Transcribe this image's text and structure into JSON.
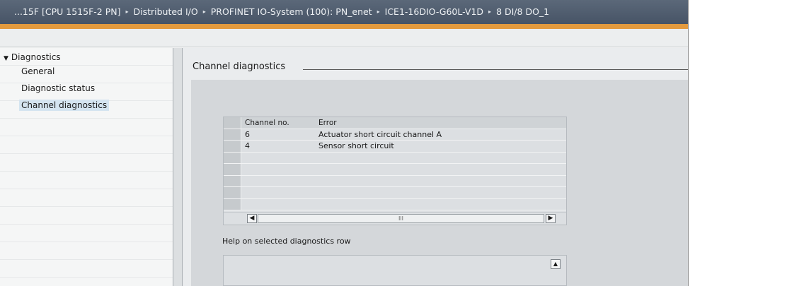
{
  "breadcrumb": [
    "...15F [CPU 1515F-2 PN]",
    "Distributed I/O",
    "PROFINET IO-System (100): PN_enet",
    "ICE1-16DIO-G60L-V1D",
    "8 DI/8 DO_1"
  ],
  "breadcrumb_separator": "▸",
  "nav": {
    "group_label": "Diagnostics",
    "items": [
      "General",
      "Diagnostic status",
      "Channel diagnostics"
    ],
    "selected": "Channel diagnostics"
  },
  "section": {
    "title": "Channel diagnostics"
  },
  "table": {
    "columns": [
      "Channel no.",
      "Error"
    ],
    "rows": [
      {
        "channel": "6",
        "error": "Actuator short circuit channel A"
      },
      {
        "channel": "4",
        "error": "Sensor short circuit"
      }
    ],
    "empty_rows": 5
  },
  "scrollbar": {
    "thumb_grip": "III"
  },
  "help": {
    "label": "Help on selected diagnostics row"
  },
  "colors": {
    "title_bar": "#4f5c6d",
    "accent_orange": "#e39a3e",
    "selection": "#d4e4f0"
  }
}
